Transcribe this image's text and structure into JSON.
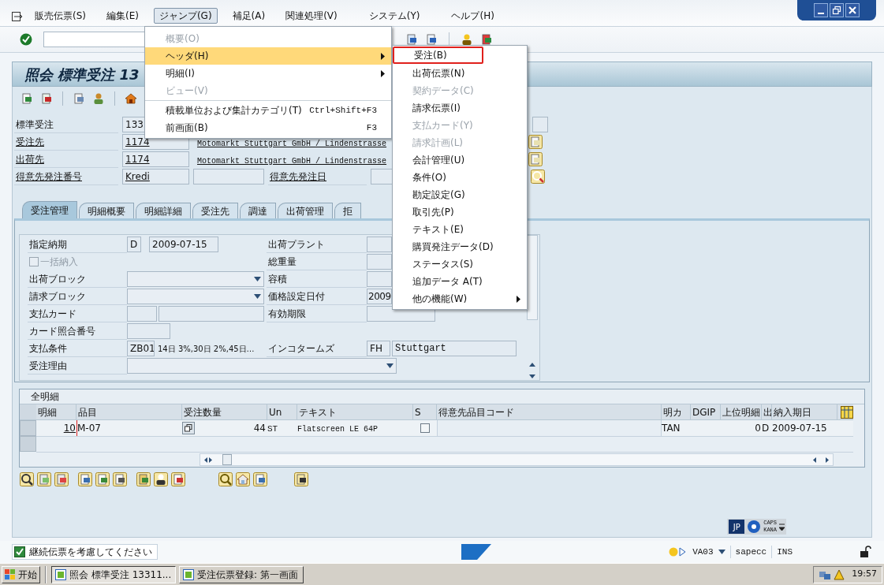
{
  "menu_bar": [
    {
      "label": "販売伝票(S)",
      "selected": false
    },
    {
      "label": "編集(E)",
      "selected": false
    },
    {
      "label": "ジャンプ(G)",
      "selected": true
    },
    {
      "label": "補足(A)",
      "selected": false
    },
    {
      "label": "関連処理(V)",
      "selected": false
    },
    {
      "label": "システム(Y)",
      "selected": false
    },
    {
      "label": "ヘルプ(H)",
      "selected": false
    }
  ],
  "jump_menu": {
    "groups": [
      [
        {
          "label": "概要(O)",
          "disabled": true,
          "selected": false,
          "submenu": false
        },
        {
          "label": "ヘッダ(H)",
          "disabled": false,
          "selected": true,
          "submenu": true
        },
        {
          "label": "明細(I)",
          "disabled": false,
          "selected": false,
          "submenu": true
        },
        {
          "label": "ビュー(V)",
          "disabled": true,
          "selected": false,
          "submenu": false
        }
      ],
      [
        {
          "label": "積載単位および集計カテゴリ(T)",
          "shortcut": "Ctrl+Shift+F3",
          "disabled": false,
          "selected": false,
          "submenu": false
        },
        {
          "label": "前画面(B)",
          "shortcut": "F3",
          "disabled": false,
          "selected": false,
          "submenu": false
        }
      ]
    ]
  },
  "header_submenu": {
    "items": [
      {
        "label": "受注(B)",
        "disabled": false,
        "marked": true,
        "submenu": false
      },
      {
        "label": "出荷伝票(N)",
        "disabled": false,
        "marked": false,
        "submenu": false
      },
      {
        "label": "契約データ(C)",
        "disabled": true,
        "marked": false,
        "submenu": false
      },
      {
        "label": "請求伝票(I)",
        "disabled": false,
        "marked": false,
        "submenu": false
      },
      {
        "label": "支払カード(Y)",
        "disabled": true,
        "marked": false,
        "submenu": false
      },
      {
        "label": "請求計画(L)",
        "disabled": true,
        "marked": false,
        "submenu": false
      },
      {
        "label": "会計管理(U)",
        "disabled": false,
        "marked": false,
        "submenu": false
      },
      {
        "label": "条件(O)",
        "disabled": false,
        "marked": false,
        "submenu": false
      },
      {
        "label": "勘定設定(G)",
        "disabled": false,
        "marked": false,
        "submenu": false
      },
      {
        "label": "取引先(P)",
        "disabled": false,
        "marked": false,
        "submenu": false
      },
      {
        "label": "テキスト(E)",
        "disabled": false,
        "marked": false,
        "submenu": false
      },
      {
        "label": "購買発注データ(D)",
        "disabled": false,
        "marked": false,
        "submenu": false
      },
      {
        "label": "ステータス(S)",
        "disabled": false,
        "marked": false,
        "submenu": false
      },
      {
        "label": "追加データ A(T)",
        "disabled": false,
        "marked": false,
        "submenu": false
      },
      {
        "label": "他の機能(W)",
        "disabled": false,
        "marked": false,
        "submenu": true
      }
    ]
  },
  "title": "照会 標準受注 13",
  "header_fields": [
    {
      "kind": "number",
      "label": "標準受注",
      "link": false,
      "value": "133"
    },
    {
      "kind": "partner",
      "label": "受注先",
      "link": true,
      "value": "1174",
      "description": "Motomarkt Stuttgart GmbH / Lindenstrasse"
    },
    {
      "kind": "partner",
      "label": "出荷先",
      "link": true,
      "value": "1174",
      "description": "Motomarkt Stuttgart GmbH / Lindenstrasse"
    },
    {
      "kind": "po",
      "label": "得意先発注番号",
      "link": true,
      "value": "Kredi",
      "date_label": "得意先発注日"
    }
  ],
  "tabs": [
    {
      "label": "受注管理",
      "selected": true
    },
    {
      "label": "明細概要",
      "selected": false
    },
    {
      "label": "明細詳細",
      "selected": false
    },
    {
      "label": "受注先",
      "selected": false
    },
    {
      "label": "調達",
      "selected": false
    },
    {
      "label": "出荷管理",
      "selected": false
    },
    {
      "label": "拒",
      "selected": false
    }
  ],
  "form_rows": [
    {
      "left": {
        "kind": "date",
        "label": "指定納期",
        "values": [
          "D",
          "2009-07-15"
        ]
      },
      "right": {
        "kind": "field",
        "label": "出荷プラント"
      }
    },
    {
      "left": {
        "kind": "checkbox",
        "label": "一括納入",
        "checked": false,
        "disabled": true
      },
      "right": {
        "kind": "field",
        "label": "総重量"
      }
    },
    {
      "left": {
        "kind": "dropdown",
        "label": "出荷ブロック"
      },
      "right": {
        "kind": "field",
        "label": "容積"
      }
    },
    {
      "left": {
        "kind": "dropdown",
        "label": "請求ブロック"
      },
      "right": {
        "kind": "field",
        "label": "価格設定日付",
        "value": "2009"
      }
    },
    {
      "left": {
        "kind": "card",
        "label": "支払カード"
      },
      "right": {
        "kind": "field",
        "label": "有効期限"
      }
    },
    {
      "left": {
        "kind": "short",
        "label": "カード照合番号"
      }
    },
    {
      "left": {
        "kind": "terms",
        "label": "支払条件",
        "code": "ZB01",
        "text": "14日 3%,30日 2%,45日…"
      },
      "right": {
        "kind": "incoterms",
        "label": "インコタームズ",
        "code": "FH",
        "place": "Stuttgart"
      }
    },
    {
      "left": {
        "kind": "wide_dropdown",
        "label": "受注理由"
      }
    }
  ],
  "items_table": {
    "title": "全明細",
    "columns": [
      "明細",
      "品目",
      "受注数量",
      "Un",
      "テキスト",
      "S",
      "得意先品目コード",
      "明カ",
      "DGIP",
      "上位明細",
      "出",
      "納入期日"
    ],
    "rows": [
      {
        "item": "10",
        "material": "M-07",
        "quantity": "44",
        "unit": "ST",
        "text": "Flatscreen LE 64P",
        "s_checked": false,
        "category": "TAN",
        "higher_item": "0",
        "delivery": "D",
        "date": "2009-07-15"
      }
    ]
  },
  "keyboard": {
    "language": "JP",
    "caps": "CAPS",
    "kana": "KANA"
  },
  "status_bar": {
    "message": "継続伝票を考慮してください",
    "transaction": "VA03",
    "server": "sapecc",
    "mode": "INS"
  },
  "taskbar": {
    "start": "开始",
    "tasks": [
      "照会 標準受注 13311...",
      "受注伝票登録: 第一画面"
    ],
    "clock": "19:57"
  }
}
